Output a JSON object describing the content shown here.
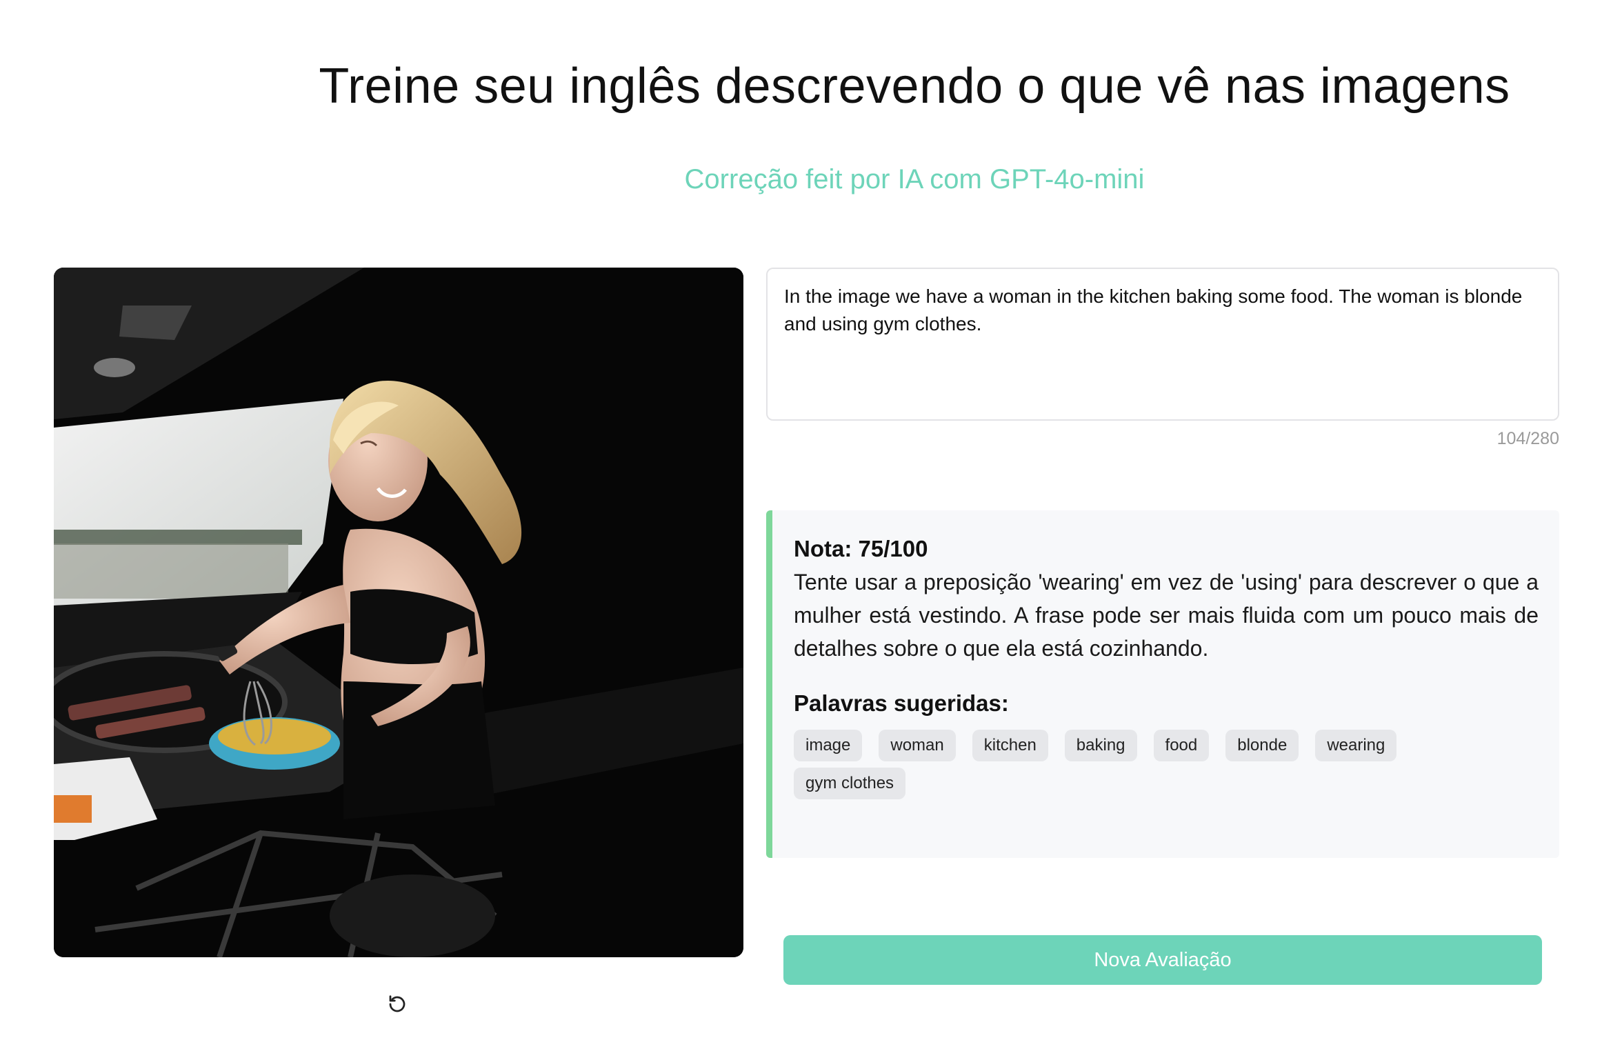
{
  "header": {
    "title": "Treine seu inglês descrevendo o que vê nas imagens",
    "subtitle": "Correção feit por IA com GPT-4o-mini"
  },
  "image": {
    "subject": "woman cooking in kitchen",
    "refresh_icon": "refresh-icon"
  },
  "answer": {
    "value": "In the image we have a woman in the kitchen baking some food. The woman is blonde and using gym clothes.",
    "counter": "104/280"
  },
  "feedback": {
    "score": "Nota: 75/100",
    "text": "Tente usar a preposição 'wearing' em vez de 'using' para descrever o que a mulher está vestindo. A frase pode ser mais fluida com um pouco mais de detalhes sobre o que ela está cozinhando.",
    "suggested_title": "Palavras sugeridas:",
    "words": [
      "image",
      "woman",
      "kitchen",
      "baking",
      "food",
      "blonde",
      "wearing",
      "gym clothes"
    ],
    "accent_color": "#7ed79a"
  },
  "actions": {
    "new_evaluation": "Nova Avaliação",
    "button_color": "#6dd4b9"
  }
}
